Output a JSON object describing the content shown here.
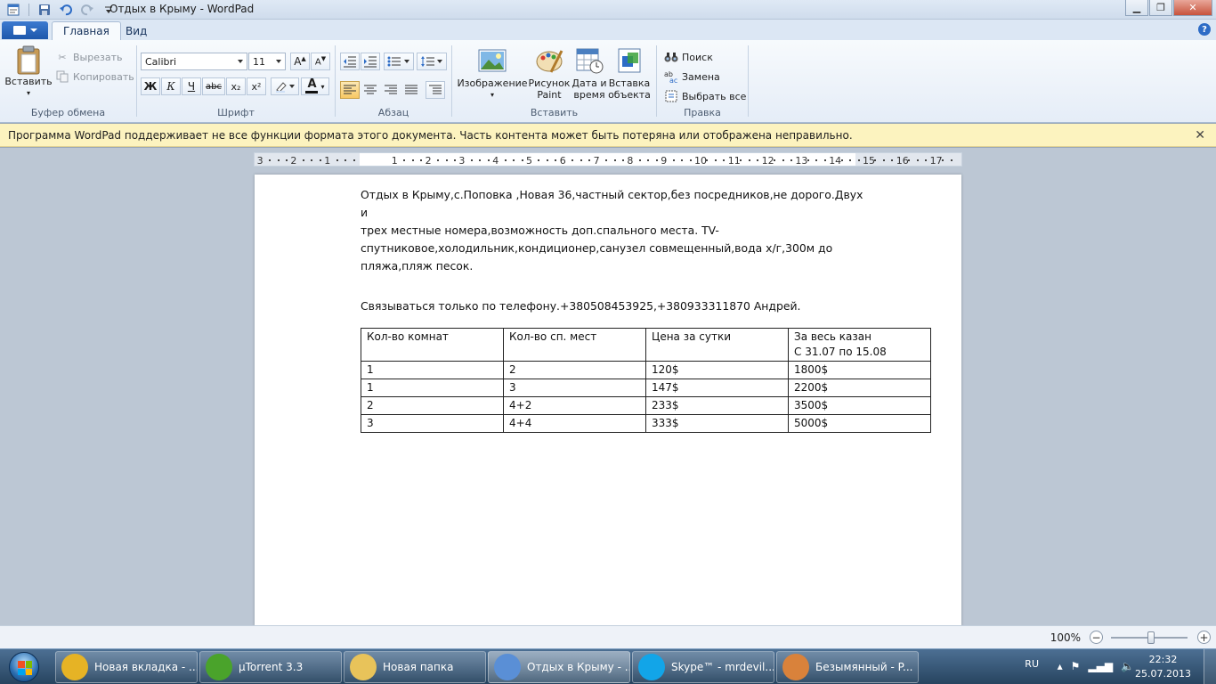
{
  "window": {
    "title": "Отдых в Крыму - WordPad"
  },
  "ribbon": {
    "tabs": [
      {
        "label": "Главная"
      },
      {
        "label": "Вид"
      }
    ],
    "clipboard": {
      "group_label": "Буфер обмена",
      "paste": "Вставить",
      "cut": "Вырезать",
      "copy": "Копировать"
    },
    "font": {
      "group_label": "Шрифт",
      "family": "Calibri",
      "size": "11",
      "bold": "Ж",
      "italic": "К",
      "underline": "Ч",
      "strike": "abc",
      "subscript": "x₂",
      "superscript": "x²",
      "color_letter": "A"
    },
    "paragraph": {
      "group_label": "Абзац"
    },
    "insert": {
      "group_label": "Вставить",
      "picture": "Изображение",
      "paint_line1": "Рисунок",
      "paint_line2": "Paint",
      "date_line1": "Дата и",
      "date_line2": "время",
      "object_line1": "Вставка",
      "object_line2": "объекта"
    },
    "editing": {
      "group_label": "Правка",
      "find": "Поиск",
      "replace": "Замена",
      "select_all": "Выбрать все"
    }
  },
  "infobar": {
    "message": "Программа WordPad поддерживает не все функции формата этого документа. Часть контента может быть потеряна или отображена неправильно."
  },
  "ruler": {
    "labels": [
      "3",
      "2",
      "1",
      "1",
      "2",
      "3",
      "4",
      "5",
      "6",
      "7",
      "8",
      "9",
      "10",
      "11",
      "12",
      "13",
      "14",
      "15",
      "16",
      "17"
    ]
  },
  "document": {
    "paragraph_lines": [
      "Отдых в Крыму,с.Поповка ,Новая 36,частный сектор,без посредников,не дорого.Двух и",
      "трех местные номера,возможность доп.спального места. TV-",
      "спутниковое,холодильник,кондиционер,санузел совмещенный,вода х/г,300м до",
      "пляжа,пляж песок."
    ],
    "contact": "Связываться только по телефону.+380508453925,+380933311870 Андрей.",
    "table": {
      "headers": [
        "Кол-во комнат",
        "Кол-во сп. мест",
        "Цена за сутки",
        "За весь казан"
      ],
      "header_note": "С 31.07 по 15.08",
      "rows": [
        [
          "1",
          "2",
          "120$",
          "1800$"
        ],
        [
          "1",
          "3",
          "147$",
          "2200$"
        ],
        [
          "2",
          "4+2",
          "233$",
          "3500$"
        ],
        [
          "3",
          "4+4",
          "333$",
          "5000$"
        ]
      ]
    }
  },
  "statusbar": {
    "zoom": "100%"
  },
  "taskbar": {
    "items": [
      {
        "label": "Новая вкладка - ...",
        "icon": "chrome-icon",
        "color": "#e6b325"
      },
      {
        "label": "µTorrent 3.3",
        "icon": "utorrent-icon",
        "color": "#4aa32b"
      },
      {
        "label": "Новая папка",
        "icon": "folder-icon",
        "color": "#e8c35a"
      },
      {
        "label": "Отдых в Крыму - ...",
        "icon": "wordpad-icon",
        "color": "#5a8fd6"
      },
      {
        "label": "Skype™ - mrdevil...",
        "icon": "skype-icon",
        "color": "#12a5e8"
      },
      {
        "label": "Безымянный - P...",
        "icon": "paint-icon",
        "color": "#d9823b"
      }
    ],
    "lang": "RU",
    "time": "22:32",
    "date": "25.07.2013"
  }
}
